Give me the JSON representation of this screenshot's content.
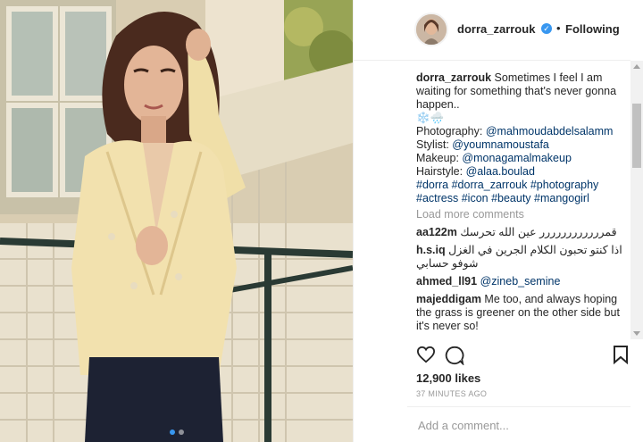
{
  "post": {
    "username": "dorra_zarrouk",
    "follow_status": "Following",
    "separator": "•",
    "verified_icon": "verified-badge-icon",
    "caption": {
      "username": "dorra_zarrouk",
      "text": "Sometimes I feel I am waiting for something that's never gonna happen..",
      "emoji_line": "❄️🌧️",
      "credits": [
        {
          "label": "Photography: ",
          "handle": "@mahmoudabdelsalamm"
        },
        {
          "label": "Stylist: ",
          "handle": "@youmnamoustafa"
        },
        {
          "label": "Makeup: ",
          "handle": "@monagamalmakeup"
        },
        {
          "label": "Hairstyle: ",
          "handle": "@alaa.boulad"
        }
      ],
      "hashtags_line1": "#dorra #dorra_zarrouk #photography",
      "hashtags_line2": "#actress #icon #beauty #mangogirl"
    },
    "load_more": "Load more comments",
    "comments": [
      {
        "username": "aa122m",
        "text": "قمرررررررررررر عين الله تحرسك"
      },
      {
        "username": "h.s.iq",
        "text": "اذا كنتو تحبون الكلام الجرين في الغزل شوفو حسابي"
      },
      {
        "username": "ahmed_ll91",
        "text": "@zineb_semine"
      },
      {
        "username": "majeddigam",
        "text": "Me too, and always hoping the grass is greener on the other side but it's never so!"
      }
    ],
    "likes": "12,900 likes",
    "time_ago": "37 MINUTES AGO",
    "add_comment_placeholder": "Add a comment..."
  },
  "colors": {
    "link": "#003569",
    "muted": "#999999",
    "verified": "#3897f0",
    "text": "#262626"
  }
}
